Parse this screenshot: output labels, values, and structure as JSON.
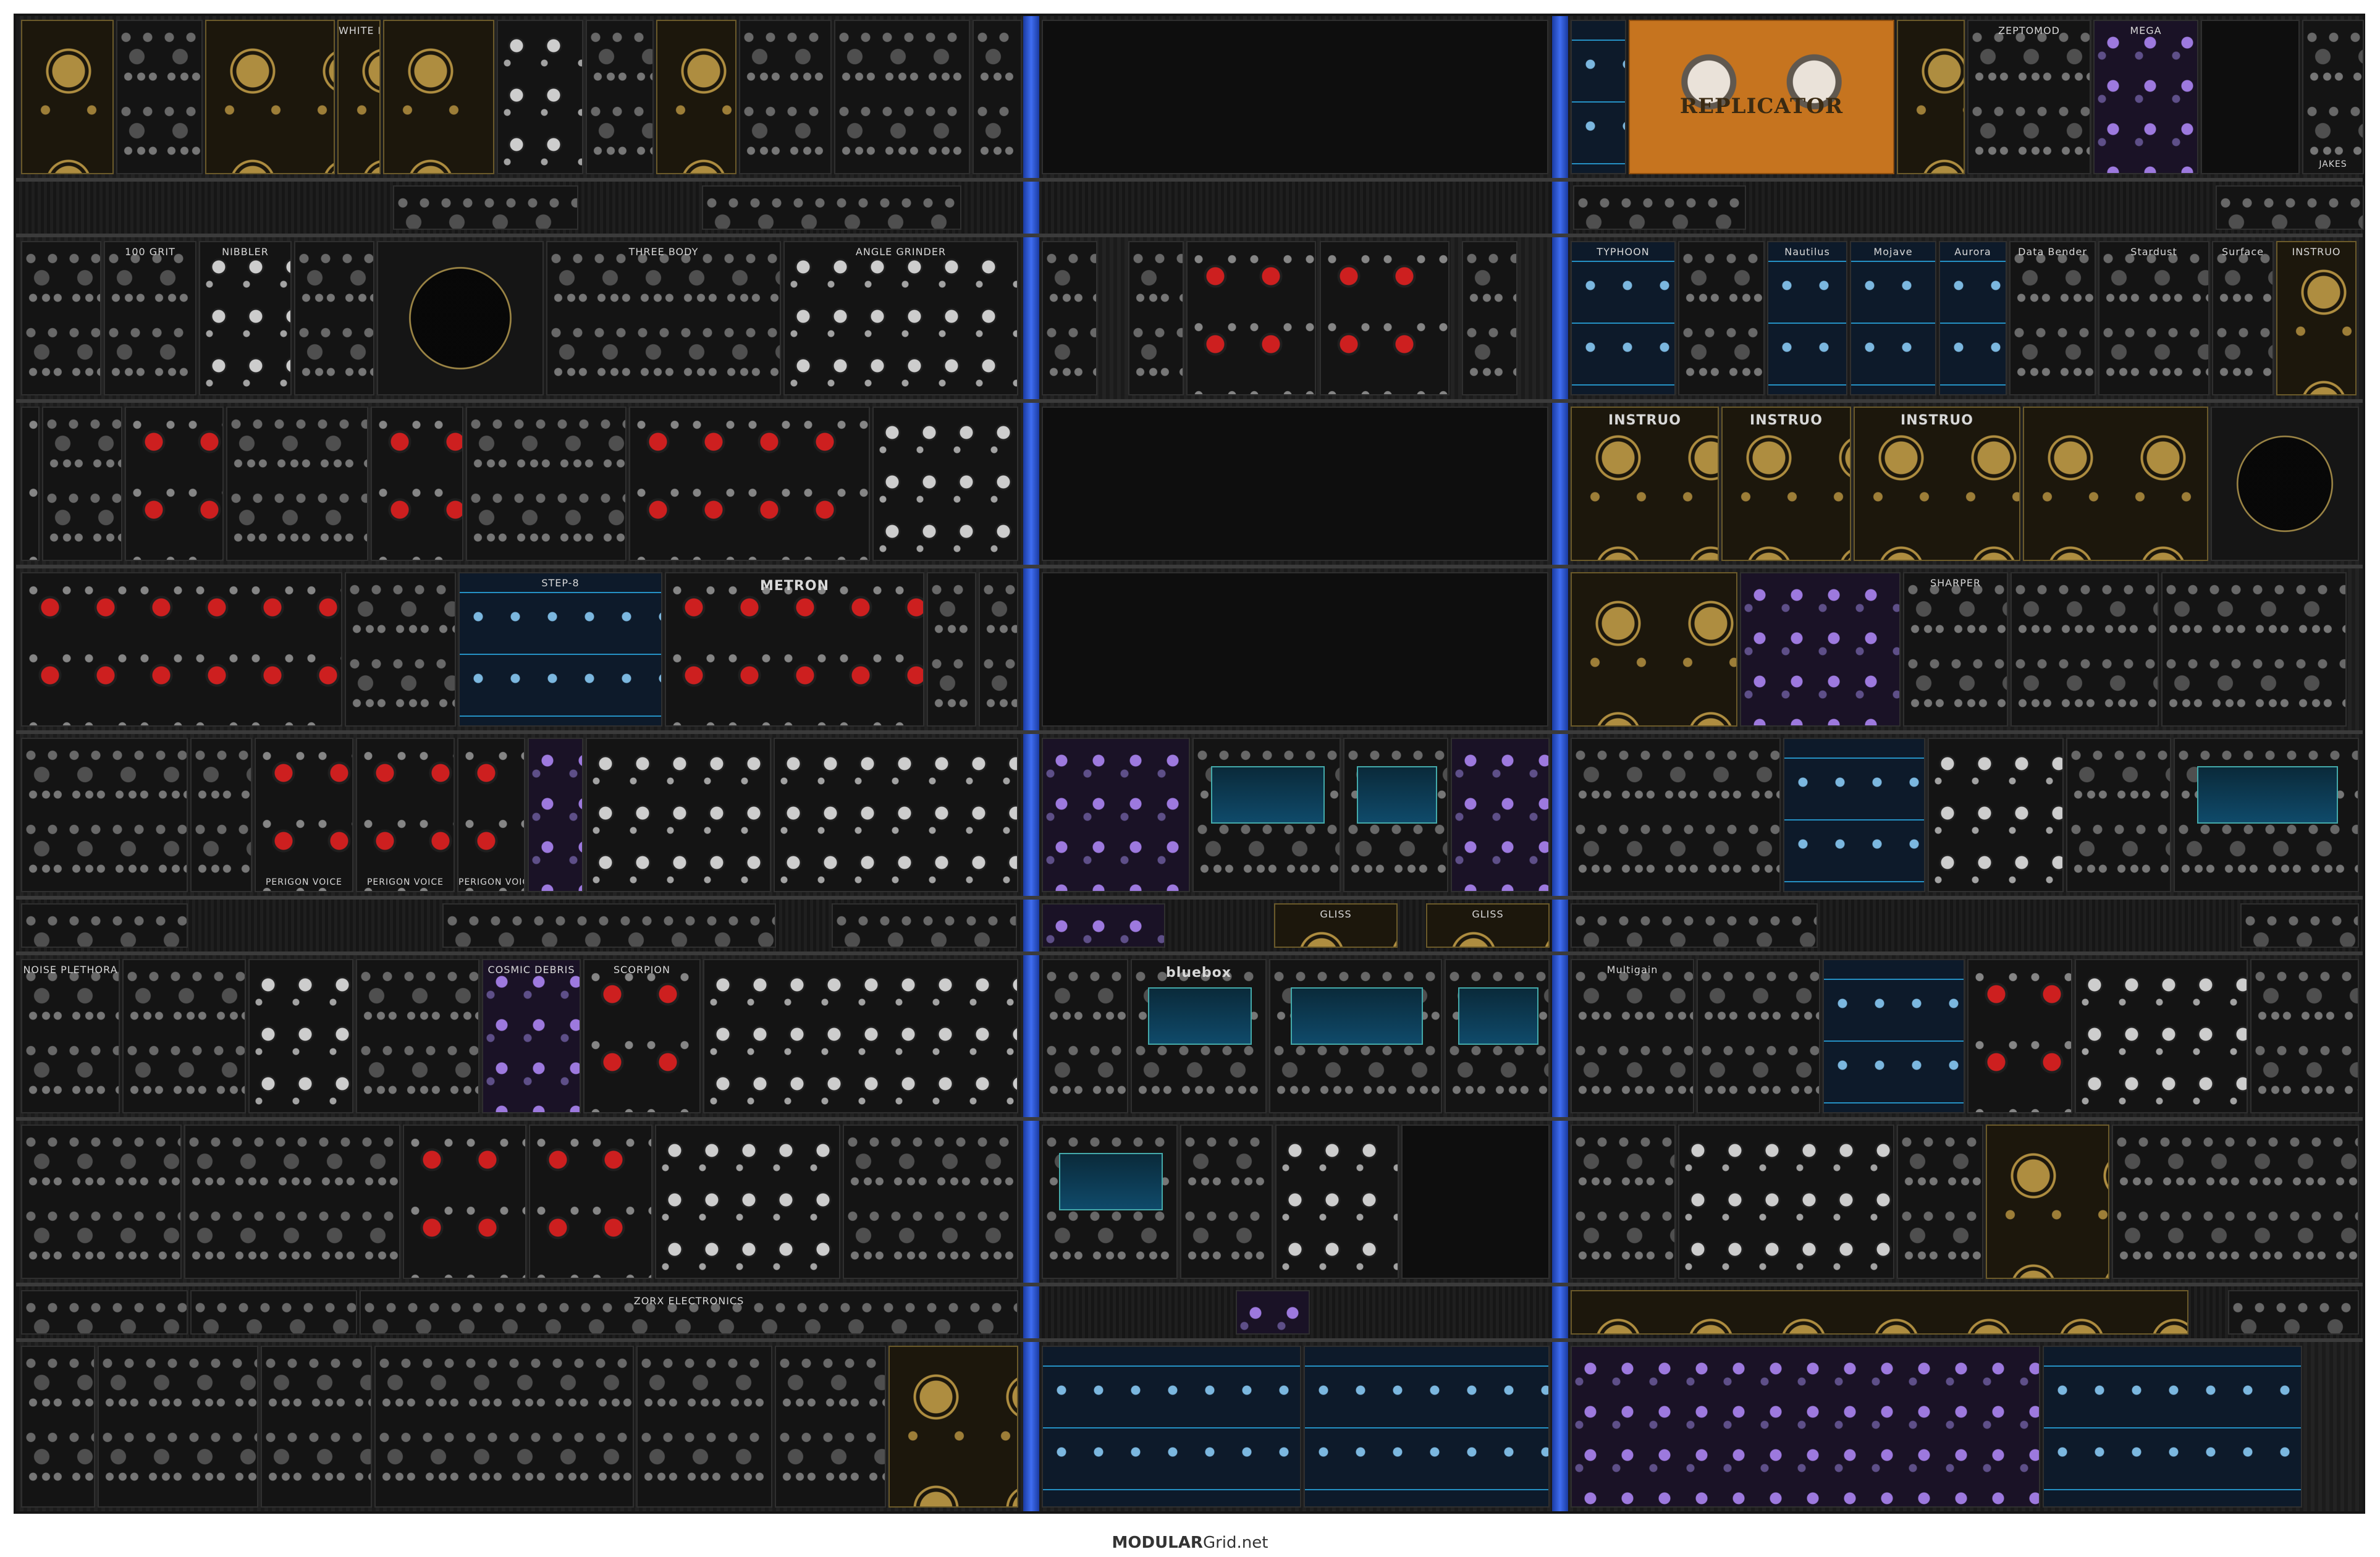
{
  "footer": {
    "brand_bold": "MODULAR",
    "brand_rest": "Grid.net"
  },
  "rows": [
    {
      "modules": [
        {
          "label": "",
          "style": "gold"
        },
        {
          "label": "",
          "style": "plain"
        },
        {
          "label": "",
          "style": "gold"
        },
        {
          "label": "WHITE RABBIT",
          "style": "gold"
        },
        {
          "label": "",
          "style": "gold"
        },
        {
          "label": "",
          "style": "white"
        },
        {
          "label": "",
          "style": "plain"
        },
        {
          "label": "",
          "style": "gold"
        },
        {
          "label": "",
          "style": "plain"
        },
        {
          "label": "",
          "style": "plain"
        },
        {
          "label": "",
          "style": "plain"
        },
        {
          "label": "",
          "style": "blue"
        },
        {
          "label": "REPLICATOR",
          "style": "orange"
        },
        {
          "label": "",
          "style": "gold"
        },
        {
          "label": "ZEPTOMOD",
          "style": "plain"
        },
        {
          "label": "MEGA",
          "style": "purple"
        },
        {
          "label": "",
          "style": "plain"
        },
        {
          "label": "JAKES",
          "style": "plain"
        }
      ]
    },
    {
      "modules": [
        {
          "label": "",
          "style": "plain"
        },
        {
          "label": "",
          "style": "plain"
        },
        {
          "label": "",
          "style": "plain"
        },
        {
          "label": "",
          "style": "plain"
        }
      ]
    },
    {
      "modules": [
        {
          "label": "",
          "style": "plain"
        },
        {
          "label": "100 GRIT",
          "style": "plain"
        },
        {
          "label": "NIBBLER",
          "style": "white"
        },
        {
          "label": "",
          "style": "plain"
        },
        {
          "label": "",
          "style": "disc"
        },
        {
          "label": "THREE BODY",
          "style": "plain"
        },
        {
          "label": "ANGLE GRINDER",
          "style": "white"
        },
        {
          "label": "",
          "style": "plain"
        },
        {
          "label": "",
          "style": "plain"
        },
        {
          "label": "",
          "style": "red"
        },
        {
          "label": "",
          "style": "red"
        },
        {
          "label": "",
          "style": "plain"
        },
        {
          "label": "TYPHOON",
          "style": "blue"
        },
        {
          "label": "",
          "style": "plain"
        },
        {
          "label": "Nautilus",
          "style": "blue"
        },
        {
          "label": "Mojave",
          "style": "blue"
        },
        {
          "label": "Aurora",
          "style": "blue"
        },
        {
          "label": "Data Bender",
          "style": "plain"
        },
        {
          "label": "Stardust",
          "style": "plain"
        },
        {
          "label": "Surface",
          "style": "plain"
        },
        {
          "label": "INSTRUO",
          "style": "gold"
        }
      ]
    },
    {
      "modules": [
        {
          "label": "",
          "style": "red"
        },
        {
          "label": "",
          "style": "plain"
        },
        {
          "label": "",
          "style": "red"
        },
        {
          "label": "",
          "style": "plain"
        },
        {
          "label": "",
          "style": "red"
        },
        {
          "label": "",
          "style": "plain"
        },
        {
          "label": "",
          "style": "red"
        },
        {
          "label": "INSTRUO",
          "style": "gold"
        },
        {
          "label": "INSTRUO",
          "style": "gold"
        },
        {
          "label": "INSTRUO",
          "style": "gold"
        },
        {
          "label": "",
          "style": "gold"
        },
        {
          "label": "",
          "style": "disc"
        }
      ]
    },
    {
      "modules": [
        {
          "label": "",
          "style": "red"
        },
        {
          "label": "",
          "style": "plain"
        },
        {
          "label": "STEP-8",
          "style": "blue"
        },
        {
          "label": "METRON",
          "style": "red"
        },
        {
          "label": "",
          "style": "plain"
        },
        {
          "label": "",
          "style": "plain"
        },
        {
          "label": "",
          "style": "gold"
        },
        {
          "label": "",
          "style": "purple"
        },
        {
          "label": "SHARPER",
          "style": "plain"
        },
        {
          "label": "",
          "style": "plain"
        },
        {
          "label": "",
          "style": "plain"
        }
      ]
    },
    {
      "modules": [
        {
          "label": "",
          "style": "plain"
        },
        {
          "label": "",
          "style": "plain"
        },
        {
          "label": "PERIGON VOICE",
          "style": "red"
        },
        {
          "label": "PERIGON VOICE",
          "style": "red"
        },
        {
          "label": "PERIGON VOICE",
          "style": "red"
        },
        {
          "label": "",
          "style": "purple"
        },
        {
          "label": "",
          "style": "white"
        },
        {
          "label": "",
          "style": "white"
        },
        {
          "label": "",
          "style": "purple"
        },
        {
          "label": "",
          "style": "screen"
        },
        {
          "label": "",
          "style": "screen"
        },
        {
          "label": "",
          "style": "purple"
        },
        {
          "label": "",
          "style": "plain"
        },
        {
          "label": "",
          "style": "blue"
        },
        {
          "label": "",
          "style": "white"
        },
        {
          "label": "",
          "style": "plain"
        },
        {
          "label": "",
          "style": "screen"
        }
      ]
    },
    {
      "modules": [
        {
          "label": "",
          "style": "plain"
        },
        {
          "label": "",
          "style": "plain"
        },
        {
          "label": "",
          "style": "plain"
        },
        {
          "label": "GLISS",
          "style": "gold"
        },
        {
          "label": "GLISS",
          "style": "gold"
        },
        {
          "label": "",
          "style": "plain"
        },
        {
          "label": "",
          "style": "plain"
        }
      ]
    },
    {
      "modules": [
        {
          "label": "NOISE PLETHORA",
          "style": "plain"
        },
        {
          "label": "",
          "style": "plain"
        },
        {
          "label": "",
          "style": "white"
        },
        {
          "label": "",
          "style": "plain"
        },
        {
          "label": "COSMIC DEBRIS",
          "style": "purple"
        },
        {
          "label": "SCORPION",
          "style": "red"
        },
        {
          "label": "",
          "style": "white"
        },
        {
          "label": "",
          "style": "plain"
        },
        {
          "label": "bluebox",
          "style": "screen"
        },
        {
          "label": "",
          "style": "screen"
        },
        {
          "label": "",
          "style": "screen"
        },
        {
          "label": "Multigain",
          "style": "plain"
        },
        {
          "label": "",
          "style": "plain"
        },
        {
          "label": "",
          "style": "blue"
        },
        {
          "label": "",
          "style": "red"
        },
        {
          "label": "",
          "style": "white"
        },
        {
          "label": "",
          "style": "plain"
        }
      ]
    },
    {
      "modules": [
        {
          "label": "",
          "style": "plain"
        },
        {
          "label": "",
          "style": "plain"
        },
        {
          "label": "",
          "style": "red"
        },
        {
          "label": "",
          "style": "red"
        },
        {
          "label": "",
          "style": "white"
        },
        {
          "label": "",
          "style": "plain"
        },
        {
          "label": "",
          "style": "screen"
        },
        {
          "label": "",
          "style": "plain"
        },
        {
          "label": "",
          "style": "white"
        },
        {
          "label": "",
          "style": "plain"
        },
        {
          "label": "",
          "style": "white"
        },
        {
          "label": "",
          "style": "plain"
        },
        {
          "label": "",
          "style": "gold"
        },
        {
          "label": "",
          "style": "plain"
        }
      ]
    },
    {
      "modules": [
        {
          "label": "",
          "style": "plain"
        },
        {
          "label": "",
          "style": "plain"
        },
        {
          "label": "ZORX ELECTRONICS",
          "style": "plain"
        },
        {
          "label": "",
          "style": "purple"
        },
        {
          "label": "",
          "style": "gold"
        },
        {
          "label": "",
          "style": "plain"
        }
      ]
    },
    {
      "modules": [
        {
          "label": "",
          "style": "plain"
        },
        {
          "label": "",
          "style": "plain"
        },
        {
          "label": "",
          "style": "plain"
        },
        {
          "label": "",
          "style": "plain"
        },
        {
          "label": "",
          "style": "plain"
        },
        {
          "label": "",
          "style": "plain"
        },
        {
          "label": "",
          "style": "plain"
        },
        {
          "label": "",
          "style": "gold"
        },
        {
          "label": "",
          "style": "blue"
        },
        {
          "label": "",
          "style": "plain"
        },
        {
          "label": "",
          "style": "purple"
        },
        {
          "label": "",
          "style": "plain"
        },
        {
          "label": "",
          "style": "blue"
        }
      ]
    }
  ]
}
